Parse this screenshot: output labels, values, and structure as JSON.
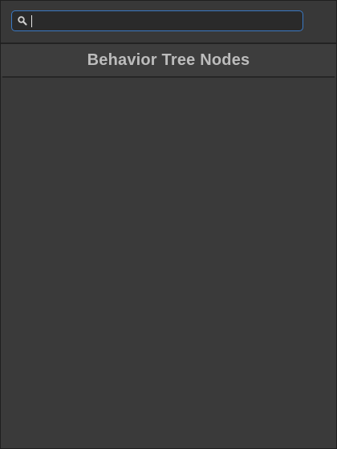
{
  "search": {
    "value": "",
    "placeholder": "",
    "icon": "search-icon"
  },
  "header": {
    "title": "Behavior Tree Nodes"
  },
  "node_list": {
    "items": []
  },
  "colors": {
    "background": "#383838",
    "header_background": "#3d3d3d",
    "search_border": "#3a79c4",
    "title_text": "#bcbcbc"
  }
}
